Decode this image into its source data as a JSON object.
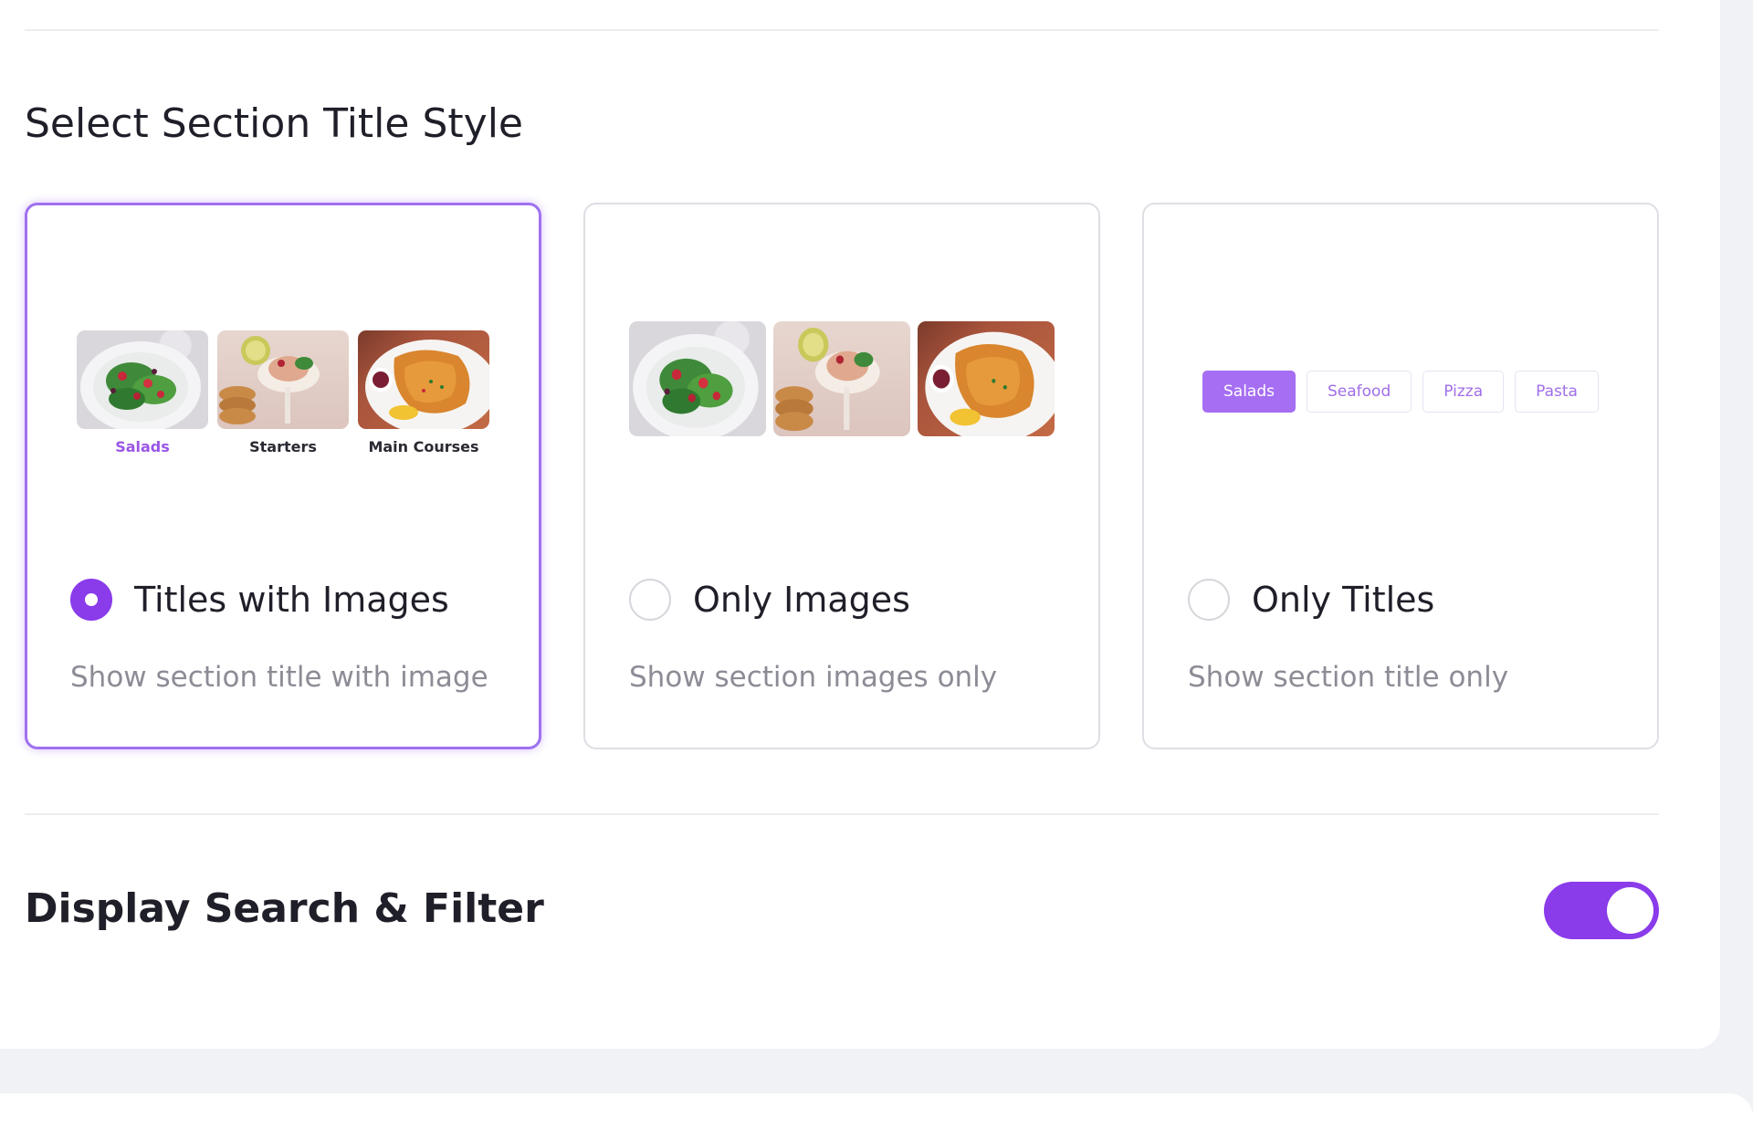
{
  "section_title_style": {
    "heading": "Select Section Title Style",
    "options": [
      {
        "label": "Titles with Images",
        "description": "Show section title with image",
        "selected": true,
        "thumbnails": [
          {
            "caption": "Salads",
            "active": true
          },
          {
            "caption": "Starters",
            "active": false
          },
          {
            "caption": "Main Courses",
            "active": false
          }
        ]
      },
      {
        "label": "Only Images",
        "description": "Show section images only",
        "selected": false
      },
      {
        "label": "Only Titles",
        "description": "Show section title only",
        "selected": false,
        "pills": [
          "Salads",
          "Seafood",
          "Pizza",
          "Pasta"
        ]
      }
    ]
  },
  "search_filter": {
    "label": "Display Search & Filter",
    "enabled": true
  },
  "colors": {
    "accent": "#8a3bea",
    "accent_light": "#a66ef2",
    "border": "#dedee4",
    "muted_text": "#8c8c96",
    "page_background": "#f1f2f6"
  }
}
